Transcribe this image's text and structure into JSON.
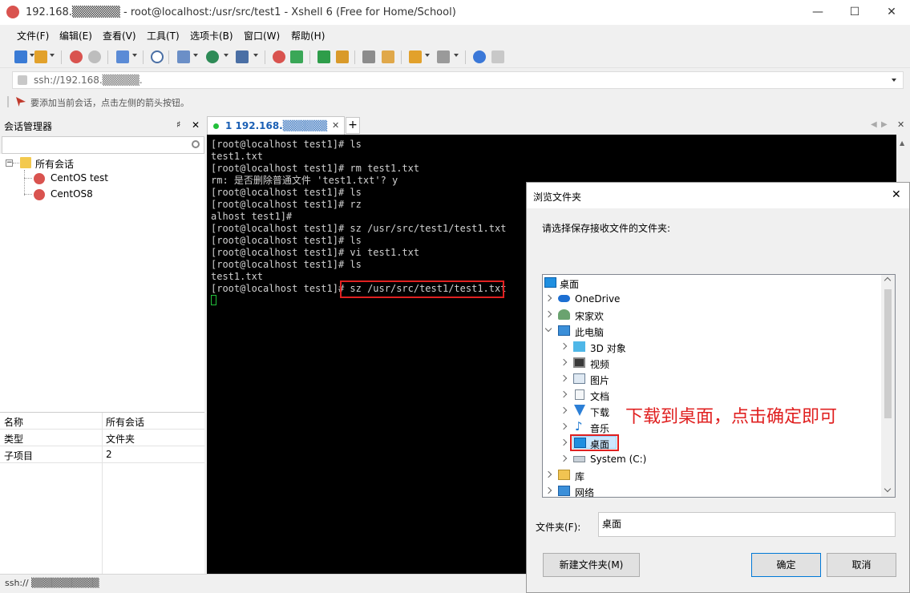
{
  "window": {
    "title": "192.168.▒▒▒▒▒▒  -  root@localhost:/usr/src/test1 - Xshell 6 (Free for Home/School)",
    "min_glyph": "—",
    "max_glyph": "☐",
    "close_glyph": "✕"
  },
  "menu": [
    "文件(F)",
    "编辑(E)",
    "查看(V)",
    "工具(T)",
    "选项卡(B)",
    "窗口(W)",
    "帮助(H)"
  ],
  "address": {
    "value": "ssh://192.168.▒▒▒▒▒."
  },
  "hint": "要添加当前会话，点击左侧的箭头按钮。",
  "session_manager": {
    "title": "会话管理器",
    "pin": "♯",
    "close": "✕",
    "tree": {
      "root": "所有会话",
      "children": [
        "CentOS test",
        "CentOS8"
      ]
    },
    "props": [
      {
        "name": "名称",
        "value": "所有会话"
      },
      {
        "name": "类型",
        "value": "文件夹"
      },
      {
        "name": "子项目",
        "value": "2"
      }
    ]
  },
  "status": {
    "text": "ssh://  ▒▒▒▒▒▒▒▒▒▒"
  },
  "tab": {
    "label": "1 192.168.▒▒▒▒▒▒",
    "close": "✕",
    "add": "+"
  },
  "terminal": {
    "lines": [
      "[root@localhost test1]# ls",
      "test1.txt",
      "[root@localhost test1]# rm test1.txt",
      "rm: 是否删除普通文件 'test1.txt'? y",
      "[root@localhost test1]# ls",
      "[root@localhost test1]# rz",
      "alhost test1]#",
      "[root@localhost test1]# sz /usr/src/test1/test1.txt",
      "[root@localhost test1]# ls",
      "[root@localhost test1]# vi test1.txt",
      "[root@localhost test1]# ls",
      "test1.txt",
      "[root@localhost test1]# sz /usr/src/test1/test1.txt"
    ],
    "highlight_color": "#e02020"
  },
  "dialog": {
    "title": "浏览文件夹",
    "close": "✕",
    "prompt": "请选择保存接收文件的文件夹:",
    "tree": [
      {
        "label": "桌面",
        "icon": "desktop-icon",
        "level": 0,
        "chevron": "none"
      },
      {
        "label": "OneDrive",
        "icon": "cloud-icon",
        "level": 1,
        "chevron": "right"
      },
      {
        "label": "宋家欢",
        "icon": "user-icon",
        "level": 1,
        "chevron": "right"
      },
      {
        "label": "此电脑",
        "icon": "computer-icon",
        "level": 1,
        "chevron": "down"
      },
      {
        "label": "3D 对象",
        "icon": "cube-icon",
        "level": 2,
        "chevron": "right"
      },
      {
        "label": "视频",
        "icon": "video-icon",
        "level": 2,
        "chevron": "right"
      },
      {
        "label": "图片",
        "icon": "picture-icon",
        "level": 2,
        "chevron": "right"
      },
      {
        "label": "文档",
        "icon": "document-icon",
        "level": 2,
        "chevron": "right"
      },
      {
        "label": "下载",
        "icon": "download-icon",
        "level": 2,
        "chevron": "right"
      },
      {
        "label": "音乐",
        "icon": "music-icon",
        "level": 2,
        "chevron": "right"
      },
      {
        "label": "桌面",
        "icon": "desktop-icon",
        "level": 2,
        "chevron": "right",
        "selected": true
      },
      {
        "label": "System (C:)",
        "icon": "drive-icon",
        "level": 2,
        "chevron": "right"
      },
      {
        "label": "库",
        "icon": "library-icon",
        "level": 1,
        "chevron": "right"
      },
      {
        "label": "网络",
        "icon": "network-icon",
        "level": 1,
        "chevron": "right"
      }
    ],
    "folder_label": "文件夹(F):",
    "folder_value": "桌面",
    "new_folder": "新建文件夹(M)",
    "ok": "确定",
    "cancel": "取消"
  },
  "annotation": {
    "text": "下载到桌面，点击确定即可",
    "color": "#e02020"
  }
}
